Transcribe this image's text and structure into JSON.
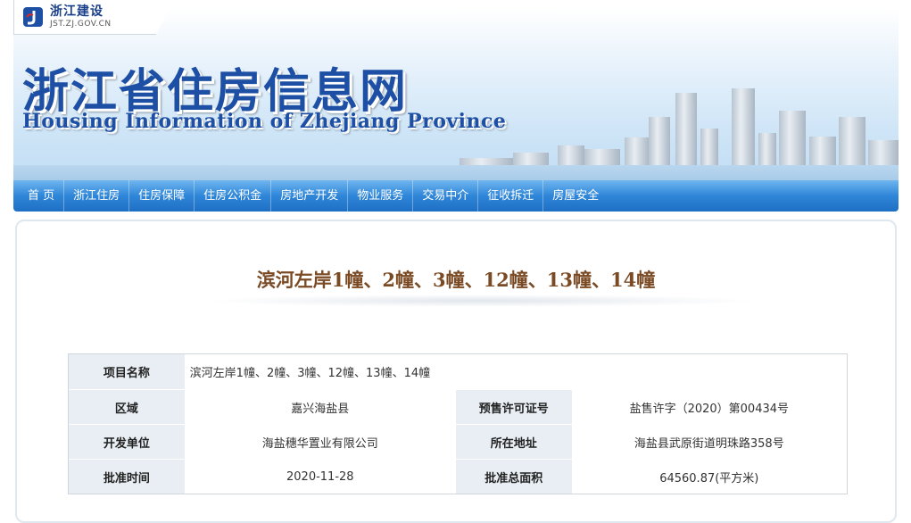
{
  "logo": {
    "name_cn": "浙江建设",
    "domain": "JST.ZJ.GOV.CN"
  },
  "banner": {
    "title_cn": "浙江省住房信息网",
    "title_en": "Housing Information of Zhejiang Province"
  },
  "nav": {
    "items": [
      "首 页",
      "浙江住房",
      "住房保障",
      "住房公积金",
      "房地产开发",
      "物业服务",
      "交易中介",
      "征收拆迁",
      "房屋安全"
    ]
  },
  "page": {
    "title": "滨河左岸1幢、2幢、3幢、12幢、13幢、14幢"
  },
  "info": {
    "project_name_label": "项目名称",
    "project_name_value": "滨河左岸1幢、2幢、3幢、12幢、13幢、14幢",
    "region_label": "区域",
    "region_value": "嘉兴海盐县",
    "presale_label": "预售许可证号",
    "presale_value": "盐售许字（2020）第00434号",
    "developer_label": "开发单位",
    "developer_value": "海盐穗华置业有限公司",
    "address_label": "所在地址",
    "address_value": "海盐县武原街道明珠路358号",
    "approve_time_label": "批准时间",
    "approve_time_value": "2020-11-28",
    "total_area_label": "批准总面积",
    "total_area_value": "64560.87(平方米)"
  },
  "colors": {
    "brand_blue": "#1d4fa5",
    "nav_blue": "#2f86d8",
    "title_brown": "#7a4a24",
    "label_bg": "#e8eef3"
  }
}
